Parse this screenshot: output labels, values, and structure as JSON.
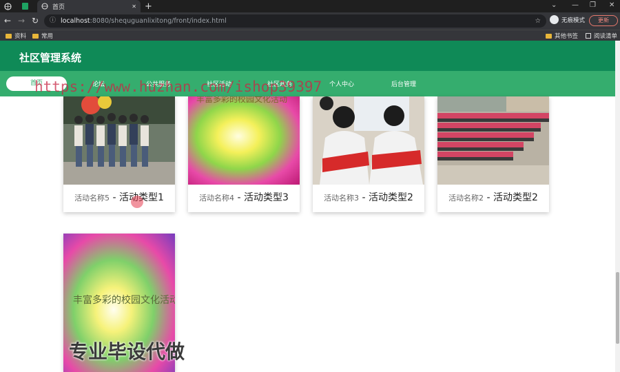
{
  "browser": {
    "tab_active_label": "首页",
    "new_tab_symbol": "+",
    "close_symbol": "✕",
    "url_host": "localhost",
    "url_rest": ":8080/shequguanlixitong/front/index.html",
    "incognito_label": "无痕模式",
    "update_label": "更新",
    "bookmarks": [
      "资料",
      "常用"
    ],
    "other_bookmarks": "其他书签",
    "reading_list": "阅读清单"
  },
  "site": {
    "title": "社区管理系统"
  },
  "nav": {
    "items": [
      "首页",
      "论坛",
      "公共服务",
      "社区活动",
      "社区政务",
      "个人中心",
      "后台管理"
    ]
  },
  "watermark": "https://www.huzhan.com/ishop39397",
  "big_watermark": "专业毕设代做",
  "cards": [
    {
      "name": "活动名称5",
      "sep": " - ",
      "type": "活动类型1"
    },
    {
      "name": "活动名称4",
      "sep": " - ",
      "type": "活动类型3"
    },
    {
      "name": "活动名称3",
      "sep": " - ",
      "type": "活动类型2"
    },
    {
      "name": "活动名称2",
      "sep": " - ",
      "type": "活动类型2"
    }
  ],
  "poster_text": "丰富多彩的校园文化活动",
  "colors": {
    "header": "#0f8a57",
    "nav": "#35ad6e"
  }
}
